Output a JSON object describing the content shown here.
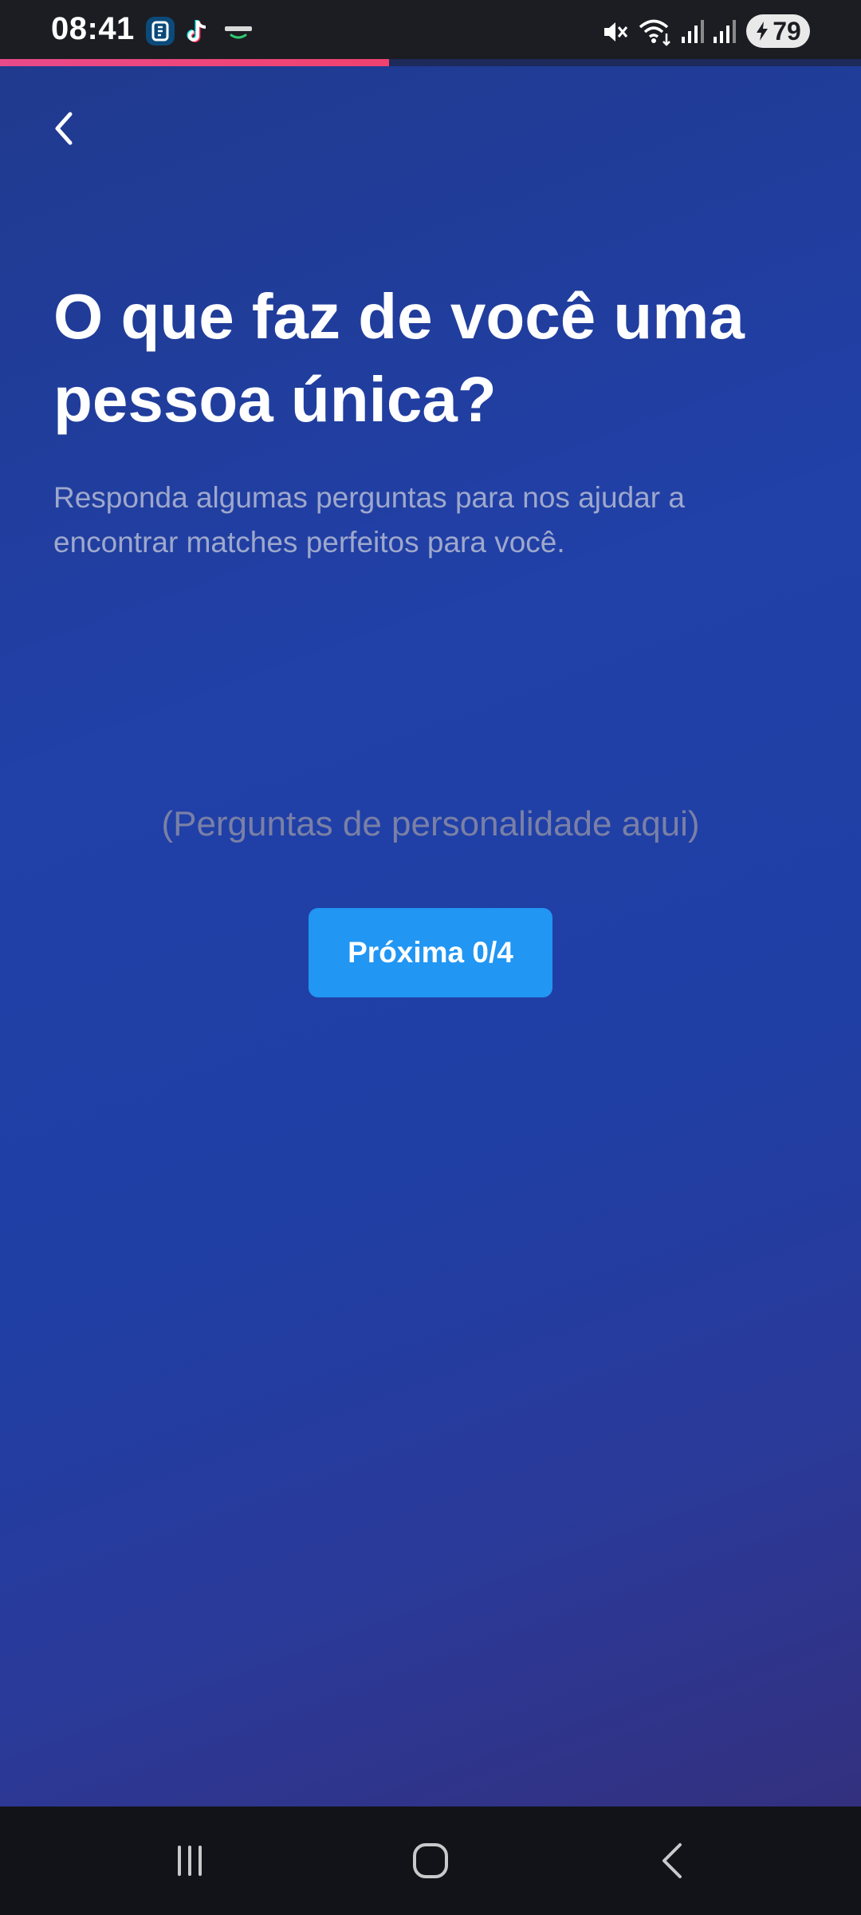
{
  "status_bar": {
    "time": "08:41",
    "battery": "79",
    "app_icons": [
      "wallet-app-icon",
      "tiktok-icon",
      "mobygo-icon"
    ],
    "indicators": [
      "mute-icon",
      "wifi-icon",
      "signal-icon",
      "signal-icon"
    ]
  },
  "progress": {
    "fraction": 0.452,
    "color": "#f0426f"
  },
  "header": {
    "back_icon": "chevron-left-icon"
  },
  "content": {
    "title": "O que faz de você uma pessoa única?",
    "subtitle": "Responda algumas perguntas para nos ajudar a encontrar matches perfeitos para você.",
    "placeholder": "(Perguntas de personalidade aqui)",
    "next_button": "Próxima 0/4"
  },
  "nav_bar": {
    "items": [
      "recent-apps-icon",
      "home-icon",
      "back-icon"
    ]
  },
  "colors": {
    "accent": "#2196f3",
    "background_start": "#203a8e",
    "background_end": "#33307f",
    "progress": "#f0426f"
  }
}
